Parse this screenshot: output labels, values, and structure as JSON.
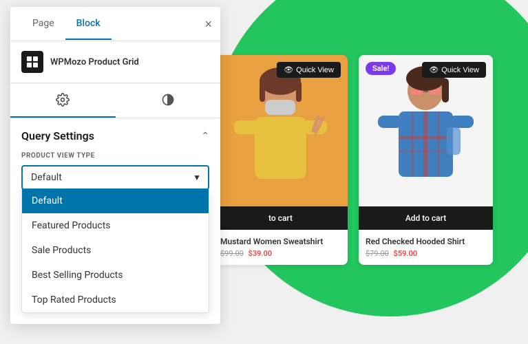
{
  "background": {
    "circle_color": "#22c55e"
  },
  "sidebar": {
    "tabs": [
      {
        "id": "page",
        "label": "Page",
        "active": false
      },
      {
        "id": "block",
        "label": "Block",
        "active": true
      }
    ],
    "close_label": "×",
    "plugin": {
      "name": "WPMozo Product Grid",
      "icon": "🏷"
    },
    "icon_tabs": [
      {
        "id": "settings",
        "icon": "gear",
        "active": true
      },
      {
        "id": "style",
        "icon": "contrast",
        "active": false
      }
    ],
    "query_section": {
      "title": "Query Settings",
      "field_label": "PRODUCT VIEW TYPE",
      "selected_value": "Default",
      "chevron": "^",
      "dropdown_items": [
        {
          "label": "Default",
          "selected": true
        },
        {
          "label": "Featured Products",
          "selected": false
        },
        {
          "label": "Sale Products",
          "selected": false
        },
        {
          "label": "Best Selling Products",
          "selected": false
        },
        {
          "label": "Top Rated Products",
          "selected": false
        }
      ]
    }
  },
  "products": [
    {
      "id": 1,
      "name": "Mustard Women Sweatshirt",
      "price_old": "$99.00",
      "price_new": "$39.00",
      "quick_view_label": "Quick View",
      "add_to_cart_label": "to cart",
      "sale_badge": null,
      "image_style": "warm"
    },
    {
      "id": 2,
      "name": "Red Checked Hooded Shirt",
      "price_old": "$79.00",
      "price_new": "$59.00",
      "quick_view_label": "Quick View",
      "add_to_cart_label": "Add to cart",
      "sale_badge": "Sale!",
      "image_style": "light"
    }
  ]
}
